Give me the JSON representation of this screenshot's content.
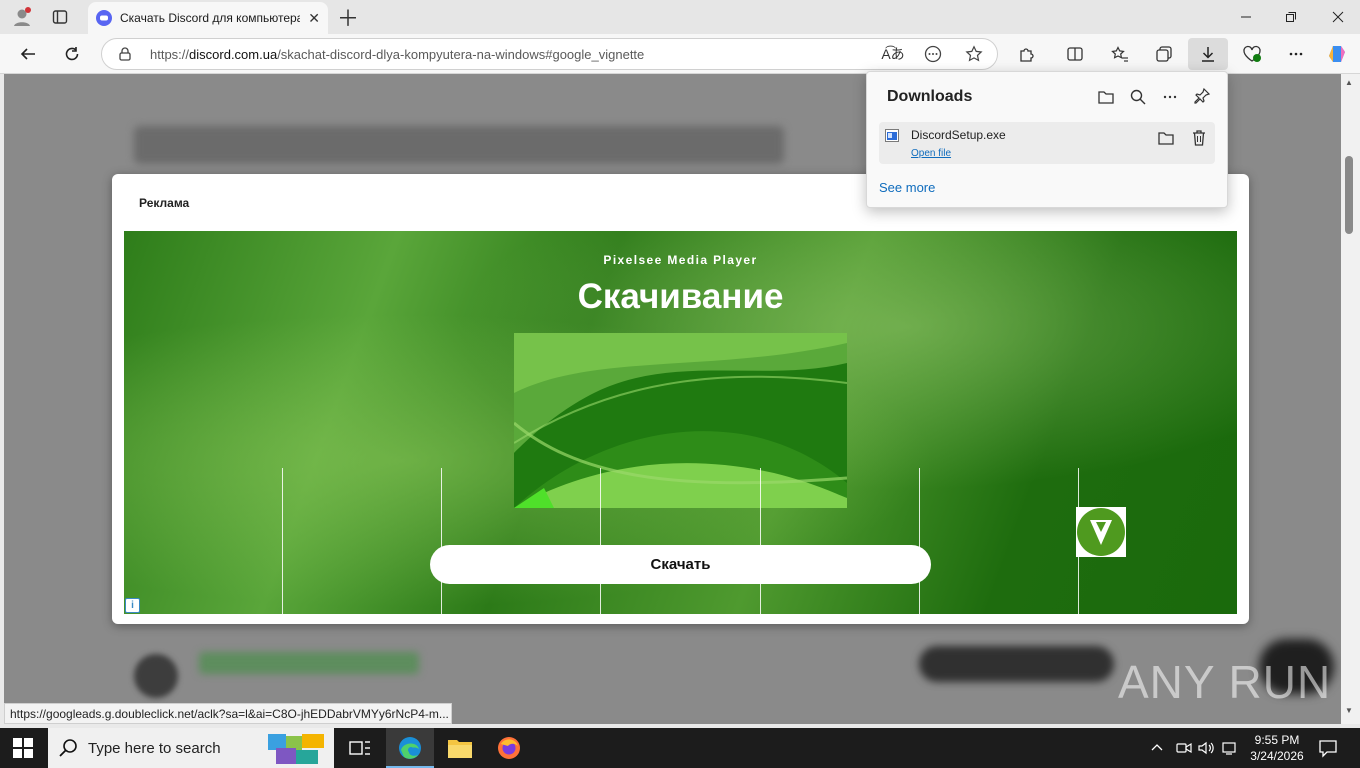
{
  "browser": {
    "tab_title": "Скачать Discord для компьютера",
    "url_prefix": "https://",
    "url_host": "discord.com.ua",
    "url_path": "/skachat-discord-dlya-kompyutera-na-windows#google_vignette"
  },
  "page": {
    "ad_label": "Реклама",
    "banner": {
      "brand": "Pixelsee Media Player",
      "heading": "Скачивание",
      "button_label": "Скачать"
    }
  },
  "downloads": {
    "title": "Downloads",
    "items": [
      {
        "filename": "DiscordSetup.exe",
        "action": "Open file"
      }
    ],
    "see_more": "See more"
  },
  "status_bar": {
    "url": "https://googleads.g.doubleclick.net/aclk?sa=l&ai=C8O-jhEDDabrVMYy6rNcP4-m..."
  },
  "watermark": "ANY RUN",
  "taskbar": {
    "search_placeholder": "Type here to search",
    "time": "9:55 PM",
    "date": "3/24/2026"
  },
  "colors": {
    "accent": "#0f6cbd",
    "banner_green": "#2e7d1a"
  }
}
